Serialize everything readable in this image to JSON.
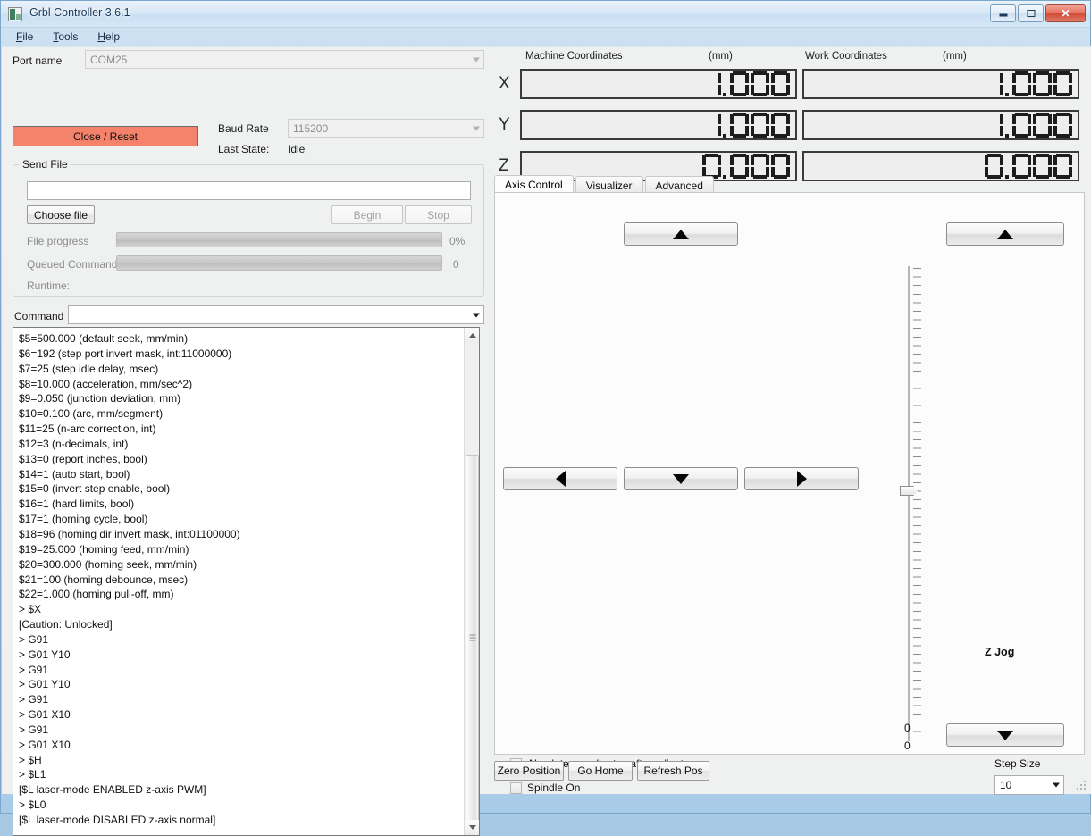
{
  "window": {
    "title": "Grbl Controller 3.6.1",
    "icon": "app-icon",
    "buttons": {
      "minimize": "minimize",
      "maximize": "maximize",
      "close": "close"
    }
  },
  "menu": [
    {
      "label": "File",
      "mnemonic": "F"
    },
    {
      "label": "Tools",
      "mnemonic": "T"
    },
    {
      "label": "Help",
      "mnemonic": "H"
    }
  ],
  "connection": {
    "port_label": "Port name",
    "port_value": "COM25",
    "connect_button": "Close / Reset",
    "connect_button_color": "#f5826a",
    "baud_label": "Baud Rate",
    "baud_value": "115200",
    "state_label": "Last State:",
    "state_value": "Idle"
  },
  "send_file": {
    "legend": "Send File",
    "path_value": "",
    "choose_button": "Choose file",
    "begin_button": "Begin",
    "stop_button": "Stop",
    "file_progress_label": "File progress",
    "file_progress_value": "0%",
    "file_progress_pct": 0,
    "queued_label": "Queued Commands",
    "queued_value": "0",
    "queued_pct": 0,
    "runtime_label": "Runtime:",
    "runtime_value": ""
  },
  "command": {
    "label": "Command",
    "value": "",
    "placeholder": ""
  },
  "console": {
    "lines": "$5=500.000 (default seek, mm/min)\n$6=192 (step port invert mask, int:11000000)\n$7=25 (step idle delay, msec)\n$8=10.000 (acceleration, mm/sec^2)\n$9=0.050 (junction deviation, mm)\n$10=0.100 (arc, mm/segment)\n$11=25 (n-arc correction, int)\n$12=3 (n-decimals, int)\n$13=0 (report inches, bool)\n$14=1 (auto start, bool)\n$15=0 (invert step enable, bool)\n$16=1 (hard limits, bool)\n$17=1 (homing cycle, bool)\n$18=96 (homing dir invert mask, int:01100000)\n$19=25.000 (homing feed, mm/min)\n$20=300.000 (homing seek, mm/min)\n$21=100 (homing debounce, msec)\n$22=1.000 (homing pull-off, mm)\n> $X\n[Caution: Unlocked]\n> G91\n> G01 Y10\n> G91\n> G01 Y10\n> G91\n> G01 X10\n> G91\n> G01 X10\n> $H\n> $L1\n[$L laser-mode ENABLED z-axis PWM]\n> $L0\n[$L laser-mode DISABLED z-axis normal]"
  },
  "coordinates": {
    "machine_title": "Machine Coordinates",
    "machine_units": "(mm)",
    "work_title": "Work Coordinates",
    "work_units": "(mm)",
    "axes": [
      {
        "name": "X",
        "machine": "1.000",
        "work": "1.000"
      },
      {
        "name": "Y",
        "machine": "1.000",
        "work": "1.000"
      },
      {
        "name": "Z",
        "machine": "0.000",
        "work": "0.000"
      }
    ]
  },
  "tabs": [
    {
      "label": "Axis Control",
      "active": true
    },
    {
      "label": "Visualizer",
      "active": false
    },
    {
      "label": "Advanced",
      "active": false
    }
  ],
  "axis_control": {
    "jog_up": "up-arrow",
    "jog_down": "down-arrow",
    "jog_left": "left-arrow",
    "jog_right": "right-arrow",
    "z_up": "up-arrow",
    "z_down": "down-arrow",
    "z_jog_label": "Z Jog",
    "slider_value_top": "0",
    "slider_value_bottom": "0",
    "absolute_checkbox": "Absolute coordinates after adjust",
    "absolute_checked": false,
    "spindle_checkbox": "Spindle On",
    "spindle_checked": false,
    "step_size_label": "Step Size",
    "step_size_value": "10"
  },
  "bottom_buttons": [
    {
      "label": "Zero Position"
    },
    {
      "label": "Go Home"
    },
    {
      "label": "Refresh Pos"
    }
  ]
}
